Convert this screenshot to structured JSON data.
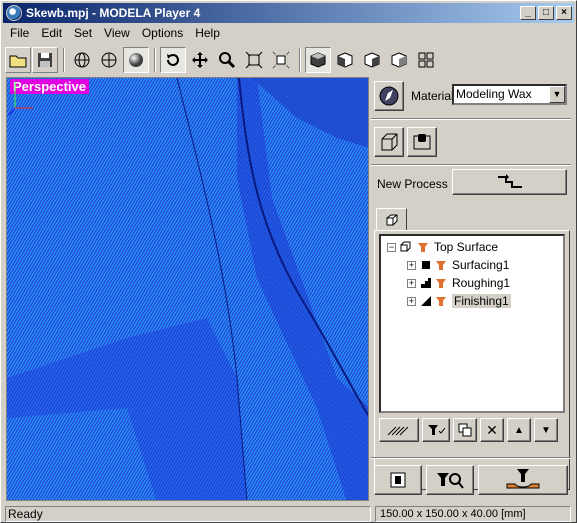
{
  "window": {
    "title": "Skewb.mpj - MODELA Player 4"
  },
  "title_buttons": {
    "minimize": "_",
    "maximize": "□",
    "close": "×"
  },
  "menu": [
    "File",
    "Edit",
    "Set",
    "View",
    "Options",
    "Help"
  ],
  "toolbar": {
    "icons": [
      "open-folder",
      "save",
      "wire-sphere",
      "axis-sphere",
      "shaded-sphere",
      "rotate",
      "pan",
      "zoom",
      "fit-view",
      "zoom-box",
      "view-iso",
      "view-front",
      "view-side",
      "view-back",
      "view-multi"
    ],
    "active": [
      "shaded-sphere",
      "rotate",
      "view-iso"
    ]
  },
  "viewport": {
    "label": "Perspective",
    "label_color": "#e000e0",
    "path_color_dark": "#1e3cd8",
    "path_color_light": "#2a8df0"
  },
  "material": {
    "label": "Material",
    "value": "Modeling Wax"
  },
  "new_process": {
    "label": "New Process"
  },
  "tree": {
    "root": "Top Surface",
    "children": [
      {
        "label": "Surfacing1",
        "mark": "square"
      },
      {
        "label": "Roughing1",
        "mark": "steps"
      },
      {
        "label": "Finishing1",
        "mark": "ramp",
        "selected": true
      }
    ]
  },
  "tree_buttons": {
    "up": "▲",
    "down": "▼",
    "delete": "✕"
  },
  "status": {
    "left": "Ready",
    "right": "150.00 x 150.00 x 40.00 [mm]"
  }
}
